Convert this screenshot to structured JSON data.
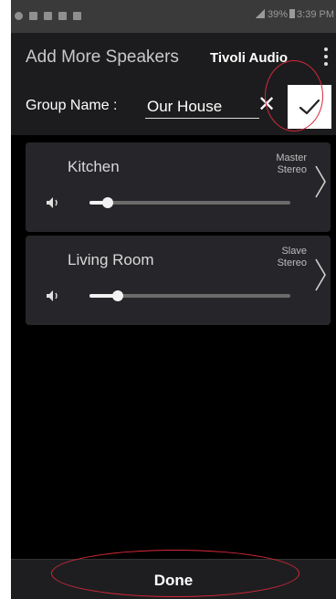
{
  "status_bar": {
    "icons": [
      "notification-icon",
      "notification-icon",
      "notification-icon",
      "warning-icon",
      "image-icon"
    ],
    "battery": "39%",
    "time": "3:39 PM"
  },
  "header": {
    "title": "Add More Speakers",
    "brand": "Tivoli Audio",
    "menu_icon": "overflow-menu-icon"
  },
  "group": {
    "label": "Group Name :",
    "value": "Our House",
    "clear_icon": "close-icon",
    "confirm_icon": "checkmark-icon"
  },
  "speakers": [
    {
      "name": "Kitchen",
      "role_line1": "Master",
      "role_line2": "Stereo",
      "volume": 0.09
    },
    {
      "name": "Living Room",
      "role_line1": "Slave",
      "role_line2": "Stereo",
      "volume": 0.14
    }
  ],
  "footer": {
    "done_label": "Done"
  },
  "colors": {
    "background": "#000000",
    "card": "#26262a",
    "highlight_ring": "#d8283a",
    "confirm_background": "#ffffff"
  }
}
